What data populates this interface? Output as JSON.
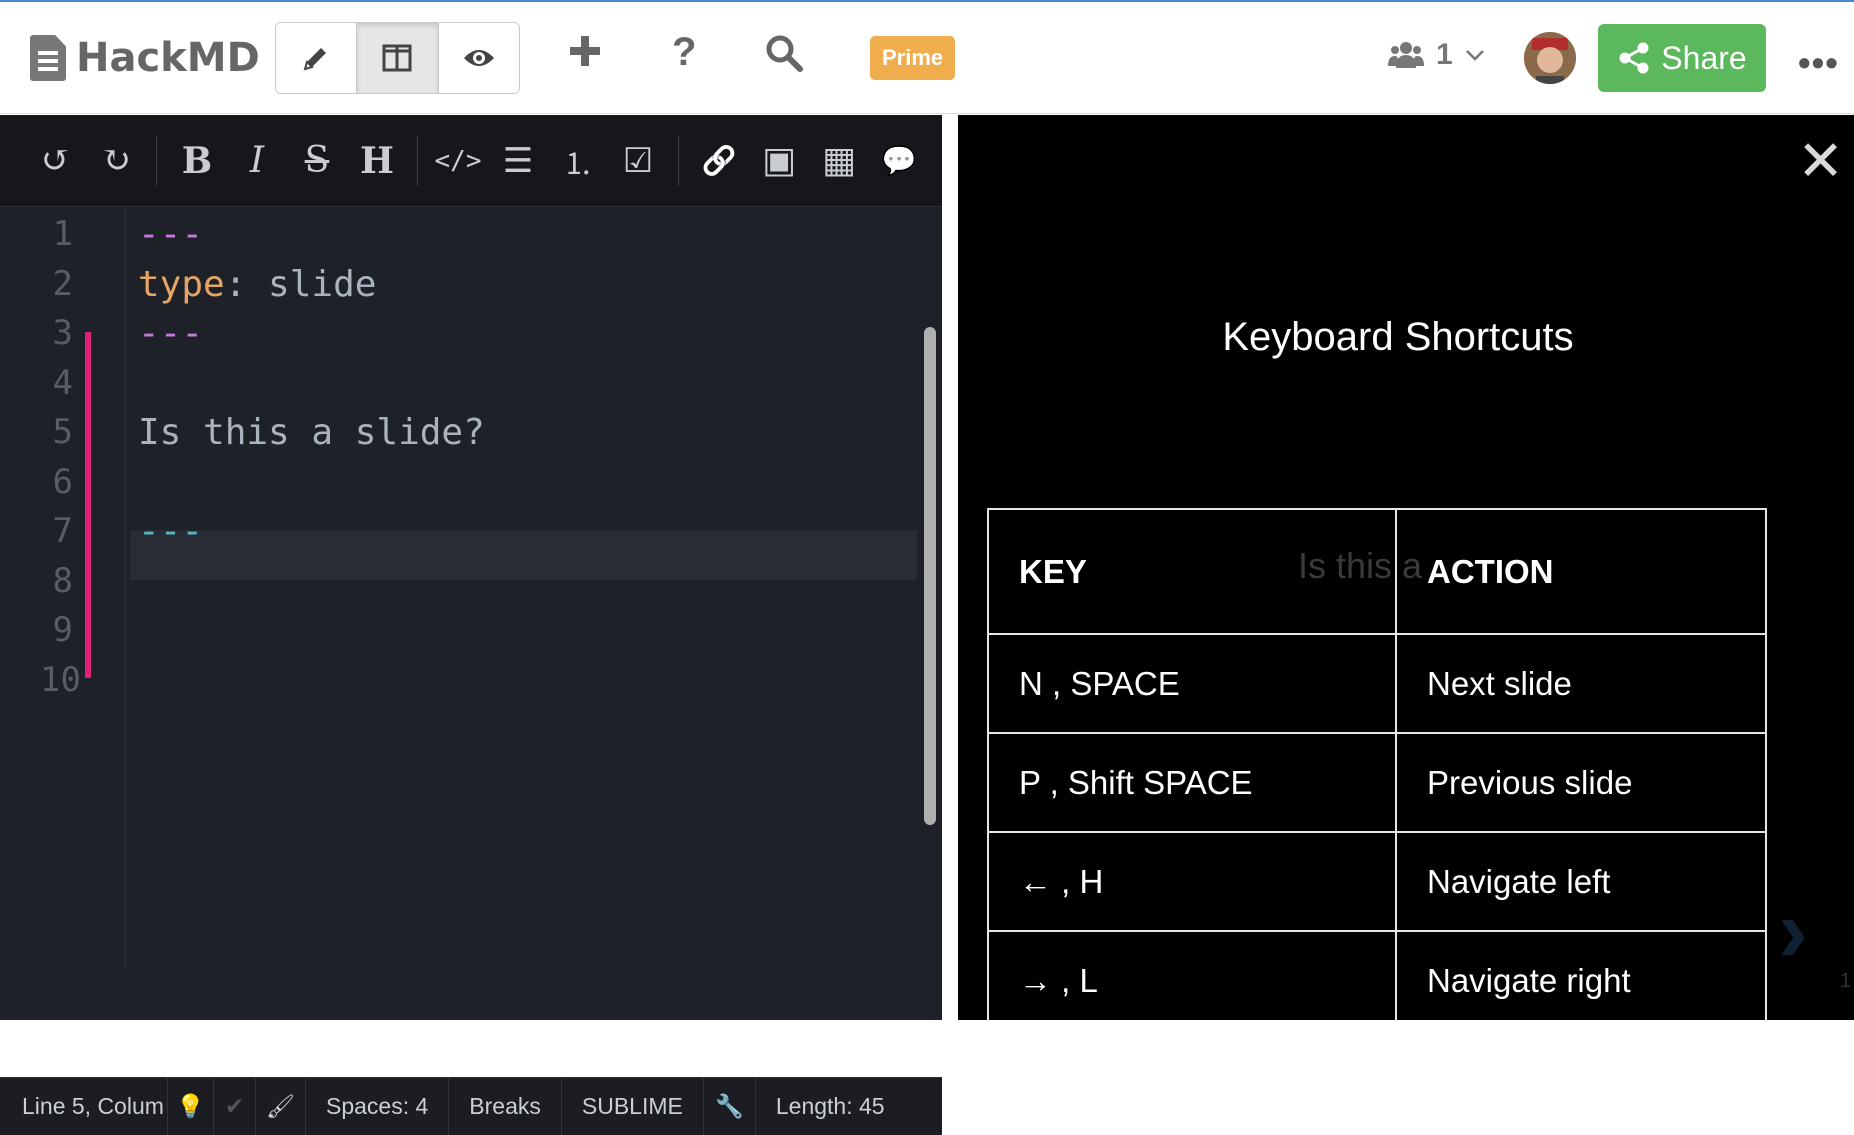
{
  "header": {
    "brand": "HackMD",
    "prime_label": "Prime",
    "online_count": "1",
    "share_label": "Share"
  },
  "icons": {
    "edit": "pencil-icon",
    "split": "columns-icon",
    "view": "eye-icon",
    "new": "plus-icon",
    "help": "question-icon",
    "search": "search-icon",
    "users": "users-icon",
    "share": "share-icon",
    "more": "ellipsis-icon"
  },
  "editor": {
    "line_numbers": [
      "1",
      "2",
      "3",
      "4",
      "5",
      "6",
      "7",
      "8",
      "9",
      "10"
    ],
    "lines": [
      {
        "tokens": [
          {
            "text": "---",
            "color": "#c678dd"
          }
        ]
      },
      {
        "tokens": [
          {
            "text": "type",
            "color": "#e5a565"
          },
          {
            "text": ": slide",
            "color": "#abb2bf"
          }
        ]
      },
      {
        "tokens": [
          {
            "text": "---",
            "color": "#c678dd"
          }
        ]
      },
      {
        "tokens": []
      },
      {
        "tokens": [
          {
            "text": "Is this a slide?",
            "color": "#abb2bf"
          }
        ]
      },
      {
        "tokens": []
      },
      {
        "tokens": [
          {
            "text": "---",
            "color": "#56b6c2"
          }
        ]
      },
      {
        "tokens": []
      },
      {
        "tokens": []
      },
      {
        "tokens": []
      }
    ]
  },
  "toolbar": {
    "undo": "↺",
    "redo": "↻",
    "bold": "B",
    "italic": "I",
    "strike": "S",
    "heading": "H",
    "code": "</>",
    "ul": "☰",
    "ol": "⒈",
    "todo": "☑",
    "link": "🔗",
    "image": "▣",
    "table": "▦",
    "comment": "💬"
  },
  "status": {
    "position": "Line 5, Colum",
    "spaces": "Spaces: 4",
    "breaks": "Breaks",
    "keymap": "SUBLIME",
    "length": "Length: 45"
  },
  "preview": {
    "title": "Keyboard Shortcuts",
    "ghost_text": "Is this a",
    "headers": [
      "KEY",
      "ACTION"
    ],
    "rows": [
      [
        "N , SPACE",
        "Next slide"
      ],
      [
        "P , Shift SPACE",
        "Previous slide"
      ],
      [
        "← , H",
        "Navigate left"
      ],
      [
        "→ , L",
        "Navigate right"
      ]
    ],
    "slide_number": "1"
  }
}
